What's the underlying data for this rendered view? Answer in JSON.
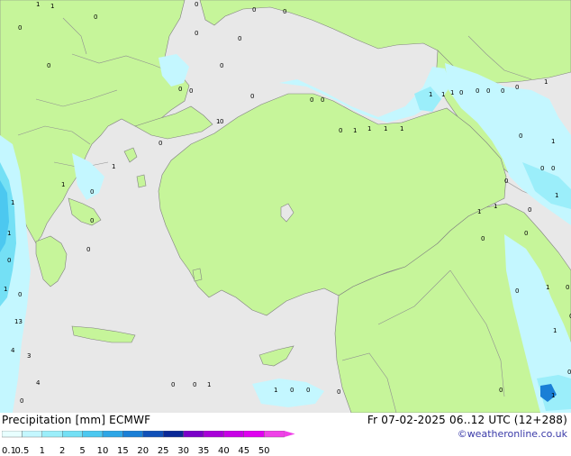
{
  "map": {
    "colors": {
      "sea": "#e8e8e8",
      "land": "#c6f59a",
      "border": "#909090",
      "coast": "#808080"
    },
    "values": [
      "1",
      "1",
      "0",
      "0",
      "0",
      "0",
      "0",
      "0",
      "0",
      "0",
      "0",
      "0",
      "0",
      "0",
      "0",
      "0",
      "1",
      "1",
      "1",
      "0",
      "0",
      "0",
      "0",
      "0",
      "1",
      "1",
      "0",
      "0",
      "1",
      "1",
      "1",
      "1",
      "1",
      "1",
      "0",
      "1",
      "0",
      "0",
      "0",
      "0",
      "1",
      "1",
      "1",
      "0",
      "1",
      "0",
      "13",
      "4",
      "3",
      "4",
      "0",
      "0",
      "0",
      "1",
      "0",
      "1",
      "0",
      "0",
      "1",
      "0",
      "0",
      "1",
      "0",
      "1",
      "0",
      "0",
      "0",
      "0",
      "1",
      "0",
      "1",
      "0",
      "0",
      "0"
    ]
  },
  "footer": {
    "title": "Precipitation [mm] ECMWF",
    "time": "Fr 07-02-2025 06..12 UTC (12+288)",
    "credit": "©weatheronline.co.uk",
    "colorbar": {
      "labels": [
        "0.1",
        "0.5",
        "1",
        "2",
        "5",
        "10",
        "15",
        "20",
        "25",
        "30",
        "35",
        "40",
        "45",
        "50"
      ],
      "colors": [
        "#e8ffff",
        "#c4f7ff",
        "#9beefa",
        "#74e0f5",
        "#4cc8f0",
        "#2ea6e6",
        "#1a7fd6",
        "#1050b8",
        "#0a2896",
        "#7a00c8",
        "#a800d8",
        "#c800e6",
        "#e000f0",
        "#f040e8"
      ]
    }
  }
}
